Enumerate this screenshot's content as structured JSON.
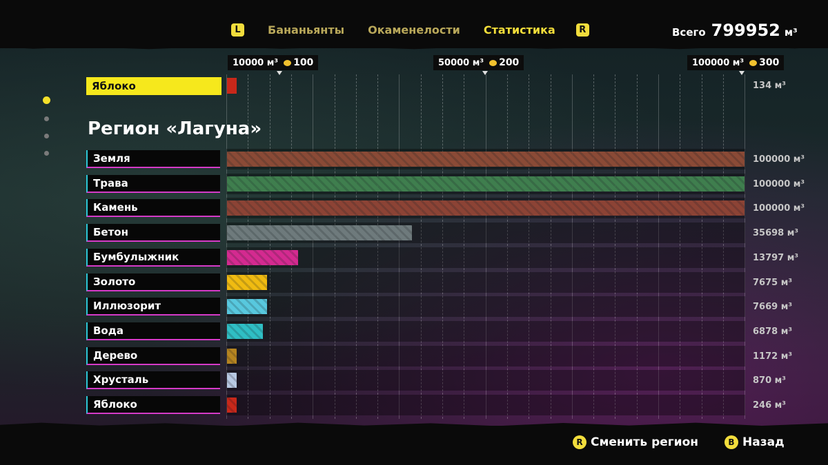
{
  "tabs": {
    "left_button": "L",
    "right_button": "R",
    "items": [
      "Бананьянты",
      "Окаменелости",
      "Статистика"
    ]
  },
  "total": {
    "label": "Всего",
    "value": "799952",
    "unit": "м³"
  },
  "markers": [
    {
      "volume": "10000 м³",
      "price": "100"
    },
    {
      "volume": "50000 м³",
      "price": "200"
    },
    {
      "volume": "100000 м³",
      "price": "300"
    }
  ],
  "selected": {
    "label": "Яблоко",
    "value": "134 м³",
    "amount": 134,
    "color": "#c8281a"
  },
  "region_title": "Регион «Лагуна»",
  "chart_data": {
    "type": "bar",
    "orientation": "horizontal",
    "xlim": [
      0,
      100000
    ],
    "unit": "м³",
    "categories": [
      "Земля",
      "Трава",
      "Камень",
      "Бетон",
      "Бумбулыжник",
      "Золото",
      "Иллюзорит",
      "Вода",
      "Дерево",
      "Хрусталь",
      "Яблоко"
    ],
    "values": [
      100000,
      100000,
      100000,
      35698,
      13797,
      7675,
      7669,
      6878,
      1172,
      870,
      246
    ],
    "value_labels": [
      "100000 м³",
      "100000 м³",
      "100000 м³",
      "35698 м³",
      "13797 м³",
      "7675 м³",
      "7669 м³",
      "6878 м³",
      "1172 м³",
      "870 м³",
      "246 м³"
    ],
    "colors": [
      "#8a4a36",
      "#3f7e4e",
      "#8c4335",
      "#6e7a7c",
      "#d42a90",
      "#f0bb11",
      "#58c8de",
      "#2fbec4",
      "#b58420",
      "#b8c9e2",
      "#c8281a"
    ]
  },
  "footer": {
    "change_region": {
      "glyph": "R",
      "label": "Сменить регион"
    },
    "back": {
      "glyph": "B",
      "label": "Назад"
    }
  }
}
